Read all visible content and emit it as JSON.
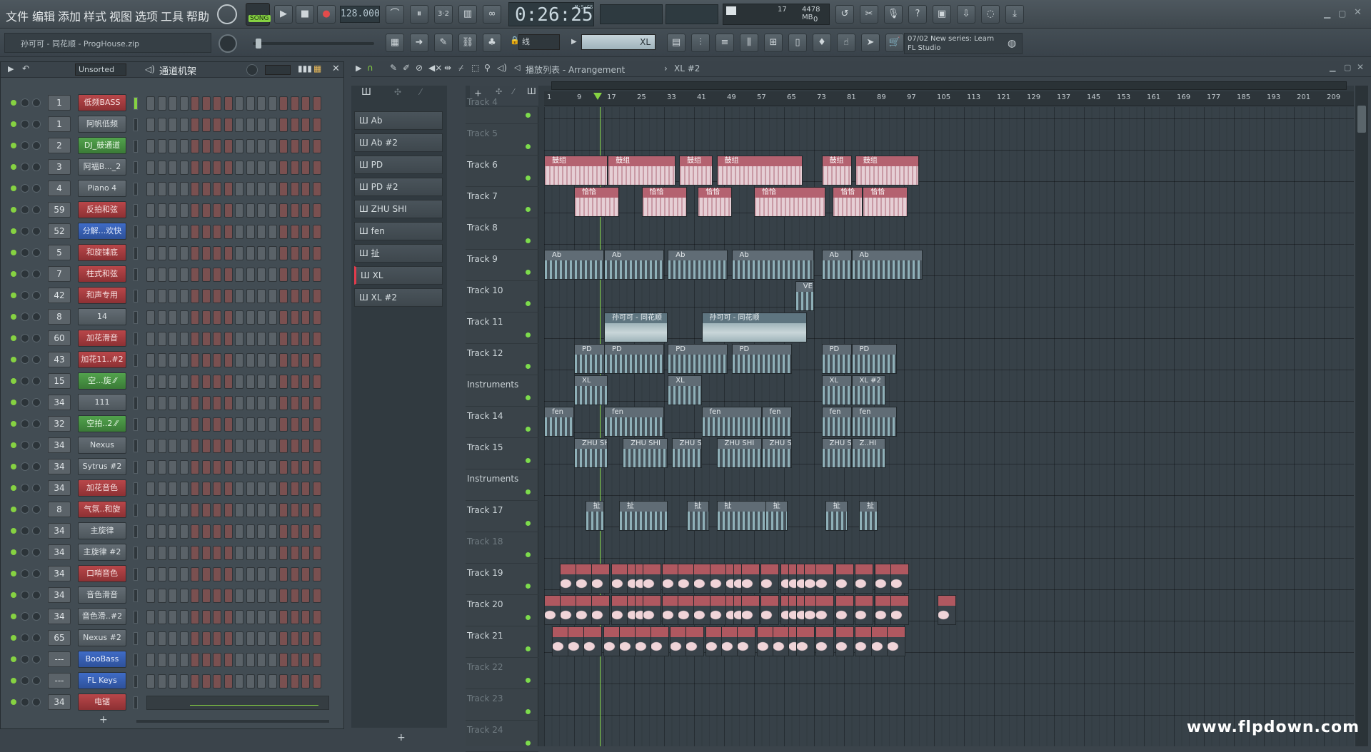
{
  "menu": [
    "文件",
    "编辑",
    "添加",
    "样式",
    "视图",
    "选项",
    "工具",
    "帮助"
  ],
  "transport": {
    "mode": "SONG",
    "tempo": "128.000",
    "time": "0:26:25",
    "time_unit": "M:S:CS",
    "cpu": "17",
    "mem": "4478 MB",
    "poly": "0"
  },
  "project": {
    "title": "孙可可 - 同花顺 - ProgHouse.zip"
  },
  "news": {
    "date": "07/02",
    "line1": "New series: Learn",
    "line2": "FL Studio"
  },
  "rack": {
    "filter": "Unsorted",
    "title": "通道机架"
  },
  "channels": [
    {
      "num": "1",
      "name": "低频BASS",
      "color": "red"
    },
    {
      "num": "1",
      "name": "阿帆低频",
      "color": "dark"
    },
    {
      "num": "2",
      "name": "DJ_鼓通道",
      "color": "grn"
    },
    {
      "num": "3",
      "name": "阿福B..._2",
      "color": "dark"
    },
    {
      "num": "4",
      "name": "Piano 4",
      "color": "dark"
    },
    {
      "num": "59",
      "name": "反拍和弦",
      "color": "red"
    },
    {
      "num": "52",
      "name": "分解...欢快",
      "color": "blu"
    },
    {
      "num": "5",
      "name": "和旋铺底",
      "color": "red"
    },
    {
      "num": "7",
      "name": "柱式和弦",
      "color": "red"
    },
    {
      "num": "42",
      "name": "和声专用",
      "color": "red"
    },
    {
      "num": "8",
      "name": "14",
      "color": "dark"
    },
    {
      "num": "60",
      "name": "加花滑音",
      "color": "red"
    },
    {
      "num": "43",
      "name": "加花11..#2",
      "color": "red"
    },
    {
      "num": "15",
      "name": "空...旋 ⁄⁄",
      "color": "grn"
    },
    {
      "num": "34",
      "name": "111",
      "color": "dark"
    },
    {
      "num": "32",
      "name": "空拍..2 ⁄⁄",
      "color": "grn"
    },
    {
      "num": "34",
      "name": "Nexus",
      "color": "dark"
    },
    {
      "num": "34",
      "name": "Sytrus #2",
      "color": "dark"
    },
    {
      "num": "34",
      "name": "加花音色",
      "color": "red"
    },
    {
      "num": "8",
      "name": "气氛..和旋",
      "color": "red"
    },
    {
      "num": "34",
      "name": "主旋律",
      "color": "dark"
    },
    {
      "num": "34",
      "name": "主旋律 #2",
      "color": "dark"
    },
    {
      "num": "34",
      "name": "口哨音色",
      "color": "red"
    },
    {
      "num": "34",
      "name": "音色滑音",
      "color": "dark"
    },
    {
      "num": "34",
      "name": "音色滑..#2",
      "color": "dark"
    },
    {
      "num": "65",
      "name": "Nexus #2",
      "color": "dark"
    },
    {
      "num": "---",
      "name": "BooBass",
      "color": "blu"
    },
    {
      "num": "---",
      "name": "FL Keys",
      "color": "blu"
    },
    {
      "num": "34",
      "name": "电锯",
      "color": "red"
    }
  ],
  "patterns": [
    "Ab",
    "Ab #2",
    "PD",
    "PD #2",
    "ZHU SHI",
    "fen",
    "扯",
    "XL",
    "XL #2"
  ],
  "playlist": {
    "title": "播放列表 - Arrangement",
    "crumb": "XL #2",
    "snap": "线",
    "selected": "XL"
  },
  "ruler": [
    "1",
    "9",
    "17",
    "25",
    "33",
    "41",
    "49",
    "57",
    "65",
    "73",
    "81",
    "89",
    "97",
    "105",
    "113",
    "121",
    "129",
    "137",
    "145",
    "153",
    "161",
    "169",
    "177",
    "185",
    "193",
    "201",
    "209"
  ],
  "tracks": [
    "Track 4",
    "Track 5",
    "Track 6",
    "Track 7",
    "Track 8",
    "Track 9",
    "Track 10",
    "Track 11",
    "Track 12",
    "Instruments",
    "Track 14",
    "Track 15",
    "Instruments",
    "Track 17",
    "Track 18",
    "Track 19",
    "Track 20",
    "Track 21",
    "Track 22",
    "Track 23",
    "Track 24"
  ],
  "clips": {
    "drums": "鼓组",
    "pick": "恰恰",
    "ab": "Ab",
    "ve": "VE..A",
    "song": "孙可可 - 同花顺",
    "pd": "PD",
    "xl": "XL",
    "xl2": "XL #2",
    "fen": "fen",
    "zhu": "ZHU SHI",
    "zhu2": "Z..HI",
    "che": "扯"
  },
  "watermark": "www.flpdown.com"
}
